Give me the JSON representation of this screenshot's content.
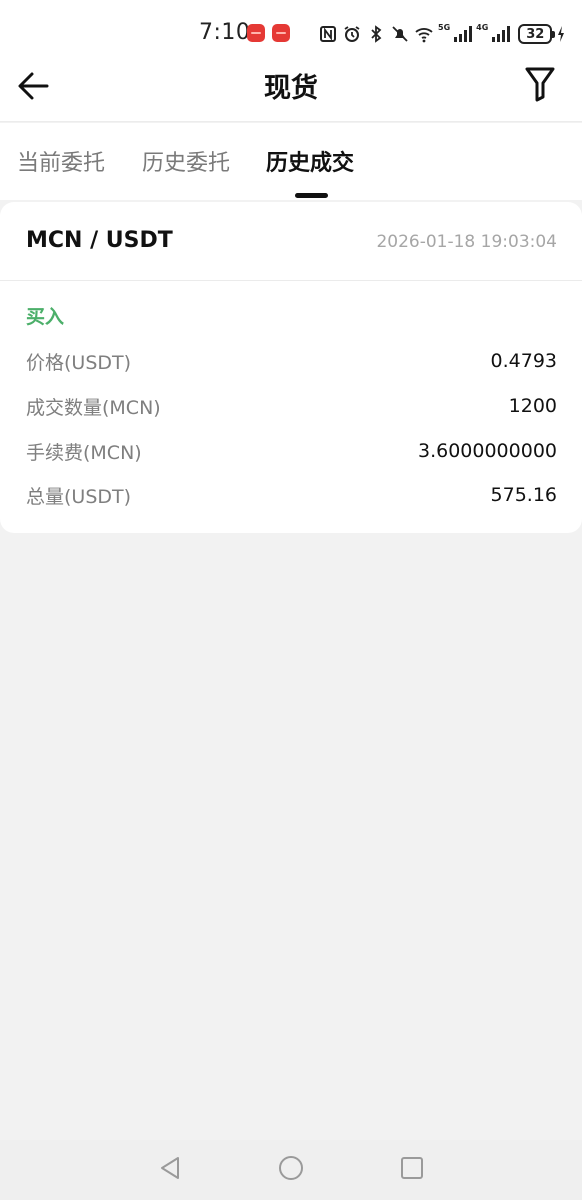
{
  "status_bar": {
    "time": "7:10",
    "signal_1_label": "5G",
    "signal_2_label": "4G",
    "battery": "32"
  },
  "header": {
    "title": "现货",
    "back_icon": "arrow-left-icon",
    "filter_icon": "filter-icon"
  },
  "tabs": [
    {
      "label": "当前委托",
      "active": false
    },
    {
      "label": "历史委托",
      "active": false
    },
    {
      "label": "历史成交",
      "active": true
    }
  ],
  "trade": {
    "pair": "MCN / USDT",
    "datetime": "2026-01-18 19:03:04",
    "side": "买入",
    "side_color": "#4caf6a",
    "rows": [
      {
        "label": "价格(USDT)",
        "value": "0.4793"
      },
      {
        "label": "成交数量(MCN)",
        "value": "1200"
      },
      {
        "label": "手续费(MCN)",
        "value": "3.6000000000"
      },
      {
        "label": "总量(USDT)",
        "value": "575.16"
      }
    ]
  },
  "nav_bar": {
    "back_icon": "triangle-back-icon",
    "home_icon": "circle-home-icon",
    "recents_icon": "square-recents-icon"
  }
}
